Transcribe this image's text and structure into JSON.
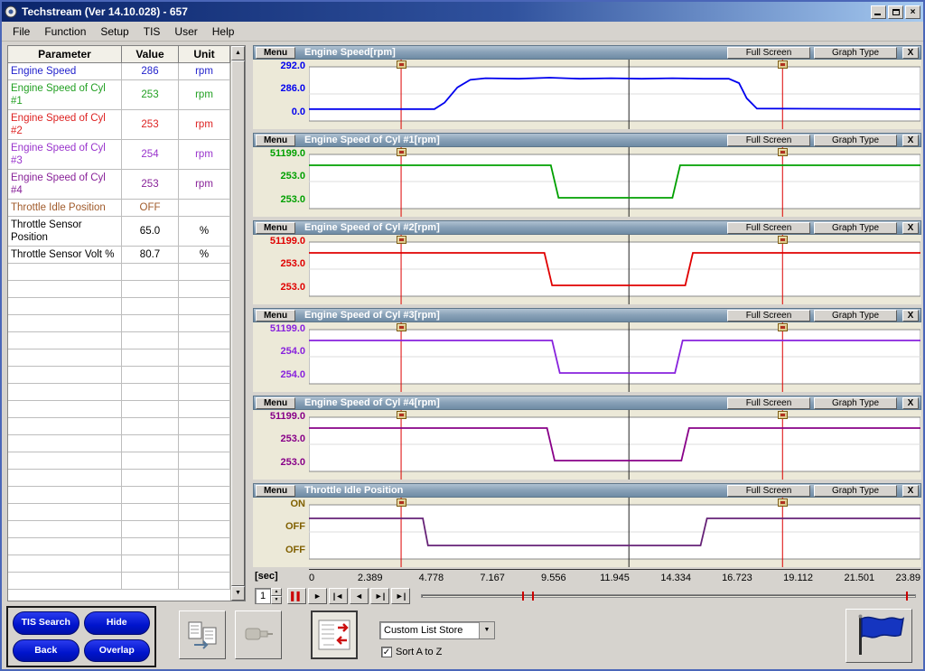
{
  "window": {
    "title": "Techstream (Ver 14.10.028) - 657"
  },
  "menubar": {
    "items": [
      "File",
      "Function",
      "Setup",
      "TIS",
      "User",
      "Help"
    ]
  },
  "param_table": {
    "headers": [
      "Parameter",
      "Value",
      "Unit"
    ],
    "rows": [
      {
        "param": "Engine Speed",
        "value": "286",
        "unit": "rpm",
        "color": "#2222cc"
      },
      {
        "param": "Engine Speed of Cyl #1",
        "value": "253",
        "unit": "rpm",
        "color": "#22a022"
      },
      {
        "param": "Engine Speed of Cyl #2",
        "value": "253",
        "unit": "rpm",
        "color": "#dd2222"
      },
      {
        "param": "Engine Speed of Cyl #3",
        "value": "254",
        "unit": "rpm",
        "color": "#9933cc"
      },
      {
        "param": "Engine Speed of Cyl #4",
        "value": "253",
        "unit": "rpm",
        "color": "#882299"
      },
      {
        "param": "Throttle Idle Position",
        "value": "OFF",
        "unit": "",
        "color": "#a05a2a"
      },
      {
        "param": "Throttle Sensor Position",
        "value": "65.0",
        "unit": "%",
        "color": "#000000"
      },
      {
        "param": "Throttle Sensor Volt %",
        "value": "80.7",
        "unit": "%",
        "color": "#000000"
      }
    ],
    "empty_rows": 19
  },
  "graph_common": {
    "menu_label": "Menu",
    "fullscreen_label": "Full Screen",
    "graphtype_label": "Graph Type",
    "close_label": "X",
    "cursor_color": "#dd0000",
    "cursors_sec": [
      3.6,
      18.5
    ],
    "center_line_sec": 12.5,
    "x_max": 23.89
  },
  "graphs": [
    {
      "title": "Engine Speed[rpm]",
      "color": "#0000ee",
      "labels": [
        "292.0",
        "286.0",
        "0.0"
      ],
      "series": [
        [
          0,
          0.22
        ],
        [
          4.9,
          0.22
        ],
        [
          5.3,
          0.34
        ],
        [
          5.8,
          0.62
        ],
        [
          6.3,
          0.76
        ],
        [
          6.9,
          0.79
        ],
        [
          8.2,
          0.78
        ],
        [
          9.4,
          0.8
        ],
        [
          10.6,
          0.78
        ],
        [
          11.8,
          0.79
        ],
        [
          13.0,
          0.78
        ],
        [
          14.2,
          0.79
        ],
        [
          15.4,
          0.78
        ],
        [
          16.4,
          0.78
        ],
        [
          16.8,
          0.7
        ],
        [
          17.1,
          0.42
        ],
        [
          17.5,
          0.23
        ],
        [
          23.89,
          0.22
        ]
      ]
    },
    {
      "title": "Engine Speed of Cyl #1[rpm]",
      "color": "#00a000",
      "labels": [
        "51199.0",
        "253.0",
        "253.0"
      ],
      "series": [
        [
          0,
          0.8
        ],
        [
          9.45,
          0.8
        ],
        [
          9.75,
          0.2
        ],
        [
          14.2,
          0.2
        ],
        [
          14.5,
          0.8
        ],
        [
          23.89,
          0.8
        ]
      ]
    },
    {
      "title": "Engine Speed of Cyl #2[rpm]",
      "color": "#e00000",
      "labels": [
        "51199.0",
        "253.0",
        "253.0"
      ],
      "series": [
        [
          0,
          0.8
        ],
        [
          9.2,
          0.8
        ],
        [
          9.5,
          0.2
        ],
        [
          14.7,
          0.2
        ],
        [
          15.0,
          0.8
        ],
        [
          23.89,
          0.8
        ]
      ]
    },
    {
      "title": "Engine Speed of Cyl #3[rpm]",
      "color": "#8822dd",
      "labels": [
        "51199.0",
        "254.0",
        "254.0"
      ],
      "series": [
        [
          0,
          0.8
        ],
        [
          9.5,
          0.8
        ],
        [
          9.8,
          0.2
        ],
        [
          14.3,
          0.2
        ],
        [
          14.6,
          0.8
        ],
        [
          23.89,
          0.8
        ]
      ]
    },
    {
      "title": "Engine Speed of Cyl #4[rpm]",
      "color": "#880088",
      "labels": [
        "51199.0",
        "253.0",
        "253.0"
      ],
      "series": [
        [
          0,
          0.8
        ],
        [
          9.3,
          0.8
        ],
        [
          9.6,
          0.2
        ],
        [
          14.55,
          0.2
        ],
        [
          14.85,
          0.8
        ],
        [
          23.89,
          0.8
        ]
      ]
    },
    {
      "title": "Throttle Idle Position",
      "color": "#662277",
      "labels": [
        "ON",
        "OFF",
        "OFF"
      ],
      "label_color": "#806000",
      "series": [
        [
          0,
          0.75
        ],
        [
          4.45,
          0.75
        ],
        [
          4.65,
          0.25
        ],
        [
          15.3,
          0.25
        ],
        [
          15.55,
          0.75
        ],
        [
          23.89,
          0.75
        ]
      ]
    }
  ],
  "timeline": {
    "unit_label": "[sec]",
    "ticks": [
      "0",
      "2.389",
      "4.778",
      "7.167",
      "9.556",
      "11.945",
      "14.334",
      "16.723",
      "19.112",
      "21.501",
      "23.89"
    ]
  },
  "playback": {
    "spinner_value": "1",
    "buttons": [
      {
        "name": "pause-button",
        "glyph": "▌▌",
        "color": "#cc0000"
      },
      {
        "name": "play-button",
        "glyph": "►"
      },
      {
        "name": "skip-start-button",
        "glyph": "|◄"
      },
      {
        "name": "step-back-button",
        "glyph": "◄"
      },
      {
        "name": "step-forward-button",
        "glyph": "►|"
      },
      {
        "name": "skip-end-button",
        "glyph": "►|"
      }
    ],
    "slider_marks": [
      20.5,
      22.5,
      98
    ]
  },
  "footer": {
    "nav_buttons": [
      {
        "name": "tis-search-button",
        "label": "TIS Search"
      },
      {
        "name": "hide-button",
        "label": "Hide"
      },
      {
        "name": "back-button",
        "label": "Back"
      },
      {
        "name": "overlap-button",
        "label": "Overlap"
      }
    ],
    "dropdown_value": "Custom List Store",
    "checkbox_label": "Sort A to Z",
    "checkbox_checked": true
  },
  "icons": {
    "app-icon": "techstream-circle-logo",
    "minimize-icon": "underscore-bar",
    "restore-icon": "overlapping-window",
    "close-icon": "x-cross",
    "cursor-flag-icon": "tan-marker-flag",
    "toolbar-icons": [
      "list-copy-icon",
      "probe-disabled-icon",
      "list-sync-red-arrows-icon"
    ],
    "flag-button-icon": "blue-flag-on-pole",
    "scroll-icons": [
      "arrow-up",
      "arrow-down"
    ]
  },
  "chart_data": [
    {
      "type": "line",
      "title": "Engine Speed[rpm]",
      "x_unit": "sec",
      "x_range": [
        0,
        23.89
      ],
      "scale_labels": [
        "292.0",
        "286.0",
        "0.0"
      ],
      "step_points": [
        [
          0,
          80
        ],
        [
          5.1,
          289
        ],
        [
          16.7,
          80
        ]
      ],
      "value_at_cursor": 286,
      "cursor_time_sec": 12.5
    },
    {
      "type": "line",
      "title": "Engine Speed of Cyl #1[rpm]",
      "x_unit": "sec",
      "x_range": [
        0,
        23.89
      ],
      "scale_labels": [
        "51199.0",
        "253.0",
        "253.0"
      ],
      "step_points": [
        [
          0,
          51199
        ],
        [
          9.5,
          253
        ],
        [
          14.4,
          51199
        ]
      ],
      "value_at_cursor": 253,
      "cursor_time_sec": 12.5
    },
    {
      "type": "line",
      "title": "Engine Speed of Cyl #2[rpm]",
      "x_unit": "sec",
      "x_range": [
        0,
        23.89
      ],
      "scale_labels": [
        "51199.0",
        "253.0",
        "253.0"
      ],
      "step_points": [
        [
          0,
          51199
        ],
        [
          9.3,
          253
        ],
        [
          14.9,
          51199
        ]
      ],
      "value_at_cursor": 253,
      "cursor_time_sec": 12.5
    },
    {
      "type": "line",
      "title": "Engine Speed of Cyl #3[rpm]",
      "x_unit": "sec",
      "x_range": [
        0,
        23.89
      ],
      "scale_labels": [
        "51199.0",
        "254.0",
        "254.0"
      ],
      "step_points": [
        [
          0,
          51199
        ],
        [
          9.6,
          254
        ],
        [
          14.4,
          51199
        ]
      ],
      "value_at_cursor": 254,
      "cursor_time_sec": 12.5
    },
    {
      "type": "line",
      "title": "Engine Speed of Cyl #4[rpm]",
      "x_unit": "sec",
      "x_range": [
        0,
        23.89
      ],
      "scale_labels": [
        "51199.0",
        "253.0",
        "253.0"
      ],
      "step_points": [
        [
          0,
          51199
        ],
        [
          9.4,
          253
        ],
        [
          14.7,
          51199
        ]
      ],
      "value_at_cursor": 253,
      "cursor_time_sec": 12.5
    },
    {
      "type": "line",
      "title": "Throttle Idle Position",
      "x_unit": "sec",
      "x_range": [
        0,
        23.89
      ],
      "scale_labels": [
        "ON",
        "OFF",
        "OFF"
      ],
      "step_points": [
        [
          0,
          "ON"
        ],
        [
          4.5,
          "OFF"
        ],
        [
          15.4,
          "ON"
        ]
      ],
      "value_at_cursor": "OFF",
      "cursor_time_sec": 12.5
    }
  ]
}
